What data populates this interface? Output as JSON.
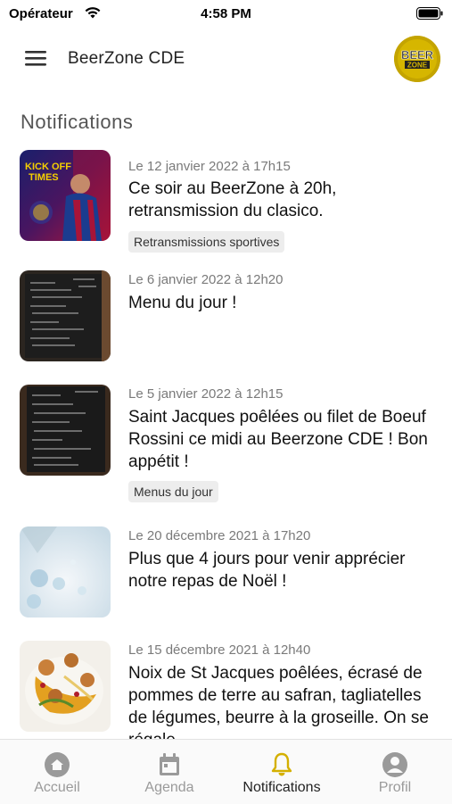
{
  "status_bar": {
    "carrier": "Opérateur",
    "time": "4:58 PM"
  },
  "header": {
    "title": "BeerZone CDE",
    "logo_text_top": "BEER",
    "logo_text_bottom": "ZONE"
  },
  "page": {
    "title": "Notifications"
  },
  "notifications": [
    {
      "date": "Le 12 janvier 2022 à 17h15",
      "title": "Ce soir au BeerZone à 20h, retransmission du clasico.",
      "tag": "Retransmissions sportives",
      "thumb_text_1": "KICK OFF",
      "thumb_text_2": "TIMES"
    },
    {
      "date": "Le 6 janvier 2022 à 12h20",
      "title": "Menu du jour !",
      "tag": ""
    },
    {
      "date": "Le 5 janvier 2022 à 12h15",
      "title": "Saint Jacques poêlées ou filet de Boeuf Rossini ce midi au Beerzone CDE ! Bon appétit !",
      "tag": "Menus du jour"
    },
    {
      "date": "Le 20 décembre 2021 à 17h20",
      "title": "Plus que 4 jours pour venir apprécier notre repas de Noël !",
      "tag": ""
    },
    {
      "date": "Le 15 décembre 2021 à 12h40",
      "title": "Noix de St Jacques poêlées, écrasé de pommes de terre au safran, tagliatelles de légumes, beurre à la groseille. On se régale",
      "tag": ""
    }
  ],
  "tabs": [
    {
      "label": "Accueil",
      "icon": "home-icon",
      "active": false
    },
    {
      "label": "Agenda",
      "icon": "calendar-icon",
      "active": false
    },
    {
      "label": "Notifications",
      "icon": "bell-icon",
      "active": true
    },
    {
      "label": "Profil",
      "icon": "user-icon",
      "active": false
    }
  ],
  "colors": {
    "accent": "#d4b000",
    "inactive": "#9a9a9a",
    "logo_bg": "#c8a800"
  }
}
